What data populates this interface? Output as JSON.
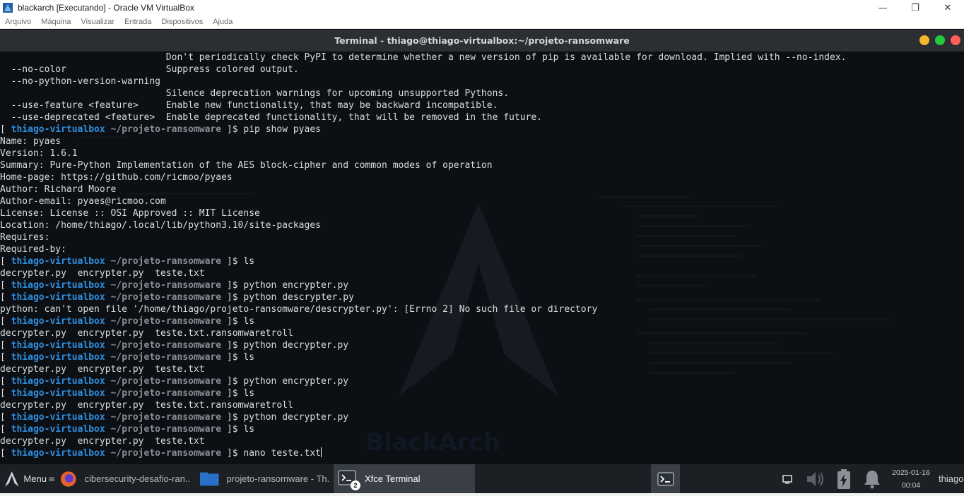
{
  "vbox": {
    "title": "blackarch [Executando] - Oracle VM VirtualBox",
    "menu": [
      "Arquivo",
      "Máquina",
      "Visualizar",
      "Entrada",
      "Dispositivos",
      "Ajuda"
    ]
  },
  "terminal": {
    "title": "Terminal - thiago@thiago-virtualbox:~/projeto-ransomware",
    "prompt_host": "thiago-virtualbox",
    "prompt_path": "~/projeto-ransomware",
    "lines": [
      {
        "kind": "out",
        "text": "                              Don't periodically check PyPI to determine whether a new version of pip is available for download. Implied with --no-index."
      },
      {
        "kind": "out",
        "text": "  --no-color                  Suppress colored output."
      },
      {
        "kind": "out",
        "text": "  --no-python-version-warning"
      },
      {
        "kind": "out",
        "text": "                              Silence deprecation warnings for upcoming unsupported Pythons."
      },
      {
        "kind": "out",
        "text": "  --use-feature <feature>     Enable new functionality, that may be backward incompatible."
      },
      {
        "kind": "out",
        "text": "  --use-deprecated <feature>  Enable deprecated functionality, that will be removed in the future."
      },
      {
        "kind": "cmd",
        "text": "pip show pyaes"
      },
      {
        "kind": "out",
        "text": "Name: pyaes"
      },
      {
        "kind": "out",
        "text": "Version: 1.6.1"
      },
      {
        "kind": "out",
        "text": "Summary: Pure-Python Implementation of the AES block-cipher and common modes of operation"
      },
      {
        "kind": "out",
        "text": "Home-page: https://github.com/ricmoo/pyaes"
      },
      {
        "kind": "out",
        "text": "Author: Richard Moore"
      },
      {
        "kind": "out",
        "text": "Author-email: pyaes@ricmoo.com"
      },
      {
        "kind": "out",
        "text": "License: License :: OSI Approved :: MIT License"
      },
      {
        "kind": "out",
        "text": "Location: /home/thiago/.local/lib/python3.10/site-packages"
      },
      {
        "kind": "out",
        "text": "Requires:"
      },
      {
        "kind": "out",
        "text": "Required-by:"
      },
      {
        "kind": "cmd",
        "text": "ls"
      },
      {
        "kind": "out",
        "text": "decrypter.py  encrypter.py  teste.txt"
      },
      {
        "kind": "cmd",
        "text": "python encrypter.py"
      },
      {
        "kind": "cmd",
        "text": "python descrypter.py"
      },
      {
        "kind": "out",
        "text": "python: can't open file '/home/thiago/projeto-ransomware/descrypter.py': [Errno 2] No such file or directory"
      },
      {
        "kind": "cmd",
        "text": "ls"
      },
      {
        "kind": "out",
        "text": "decrypter.py  encrypter.py  teste.txt.ransomwaretroll"
      },
      {
        "kind": "cmd",
        "text": "python decrypter.py"
      },
      {
        "kind": "cmd",
        "text": "ls"
      },
      {
        "kind": "out",
        "text": "decrypter.py  encrypter.py  teste.txt"
      },
      {
        "kind": "cmd",
        "text": "python encrypter.py"
      },
      {
        "kind": "cmd",
        "text": "ls"
      },
      {
        "kind": "out",
        "text": "decrypter.py  encrypter.py  teste.txt.ransomwaretroll"
      },
      {
        "kind": "cmd",
        "text": "python decrypter.py"
      },
      {
        "kind": "cmd",
        "text": "ls"
      },
      {
        "kind": "out",
        "text": "decrypter.py  encrypter.py  teste.txt"
      },
      {
        "kind": "cmd",
        "text": "nano teste.txt",
        "current": true
      }
    ]
  },
  "taskbar": {
    "menu_label": "Menu",
    "tasks": [
      {
        "label": "cibersecurity-desafio-ran...",
        "icon": "firefox-icon"
      },
      {
        "label": "projeto-ransomware - Th...",
        "icon": "folder-icon"
      },
      {
        "label": "Xfce Terminal",
        "icon": "terminal-icon",
        "badge": "2",
        "active": true
      }
    ],
    "date": "2025-01-16",
    "time": "00:04",
    "user": "thiago"
  },
  "colors": {
    "prompt_host": "#2f8fe0",
    "prompt_path": "#8a8f96",
    "terminal_bg": "#0c0f13"
  }
}
